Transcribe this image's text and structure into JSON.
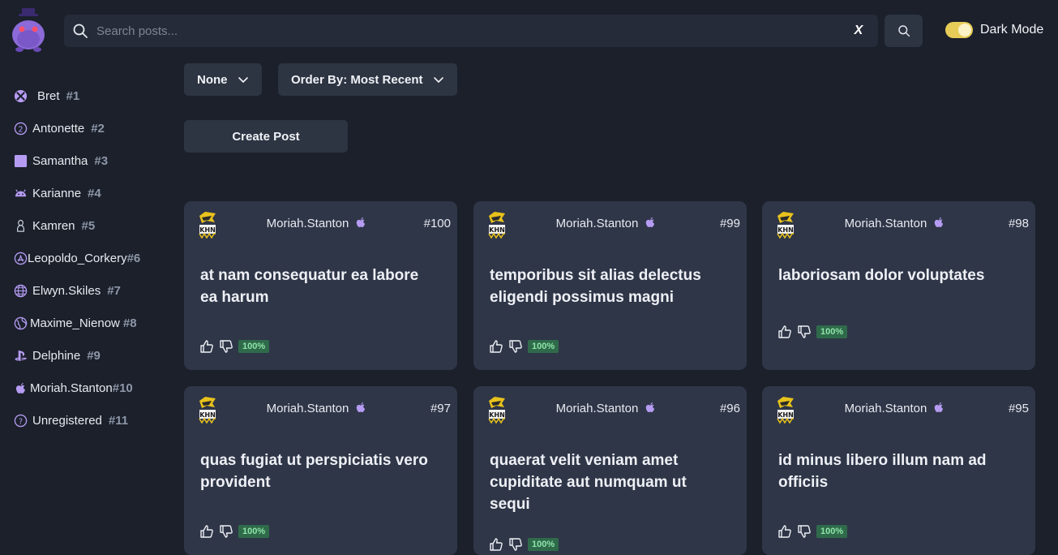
{
  "search": {
    "placeholder": "Search posts...",
    "clear_label": "X"
  },
  "theme": {
    "label": "Dark Mode",
    "enabled": true
  },
  "sidebar": {
    "items": [
      {
        "name": "Bret",
        "number": "#1",
        "icon": "xbox-icon"
      },
      {
        "name": "Antonette",
        "number": "#2",
        "icon": "circled-two-icon"
      },
      {
        "name": "Samantha",
        "number": "#3",
        "icon": "square-icon"
      },
      {
        "name": "Karianne",
        "number": "#4",
        "icon": "android-icon"
      },
      {
        "name": "Kamren",
        "number": "#5",
        "icon": "linux-icon"
      },
      {
        "name": "Leopoldo_Corkery",
        "number": "#6",
        "icon": "app-store-icon"
      },
      {
        "name": "Elwyn.Skiles",
        "number": "#7",
        "icon": "globe-icon"
      },
      {
        "name": "Maxime_Nienow",
        "number": "#8",
        "icon": "earth-icon"
      },
      {
        "name": "Delphine",
        "number": "#9",
        "icon": "playstation-icon"
      },
      {
        "name": "Moriah.Stanton",
        "number": "#10",
        "icon": "apple-icon"
      },
      {
        "name": "Unregistered",
        "number": "#11",
        "icon": "question-icon"
      }
    ]
  },
  "filters": {
    "category": "None",
    "order": "Order By: Most Recent"
  },
  "actions": {
    "create_post": "Create Post"
  },
  "posts": [
    {
      "author": "Moriah.Stanton",
      "number": "#100",
      "title": "at nam consequatur ea labore ea harum",
      "score": "100%"
    },
    {
      "author": "Moriah.Stanton",
      "number": "#99",
      "title": "temporibus sit alias delectus eligendi possimus magni",
      "score": "100%"
    },
    {
      "author": "Moriah.Stanton",
      "number": "#98",
      "title": "laboriosam dolor voluptates",
      "score": "100%"
    },
    {
      "author": "Moriah.Stanton",
      "number": "#97",
      "title": "quas fugiat ut perspiciatis vero provident",
      "score": "100%"
    },
    {
      "author": "Moriah.Stanton",
      "number": "#96",
      "title": "quaerat velit veniam amet cupiditate aut numquam ut sequi",
      "score": "100%"
    },
    {
      "author": "Moriah.Stanton",
      "number": "#95",
      "title": "id minus libero illum nam ad officiis",
      "score": "100%"
    }
  ],
  "colors": {
    "background": "#1b202b",
    "card": "#2f3648",
    "control": "#2d3442",
    "accent_purple": "#a98bf0",
    "toggle": "#e7cc57",
    "score_badge": "#2f6b4a"
  }
}
